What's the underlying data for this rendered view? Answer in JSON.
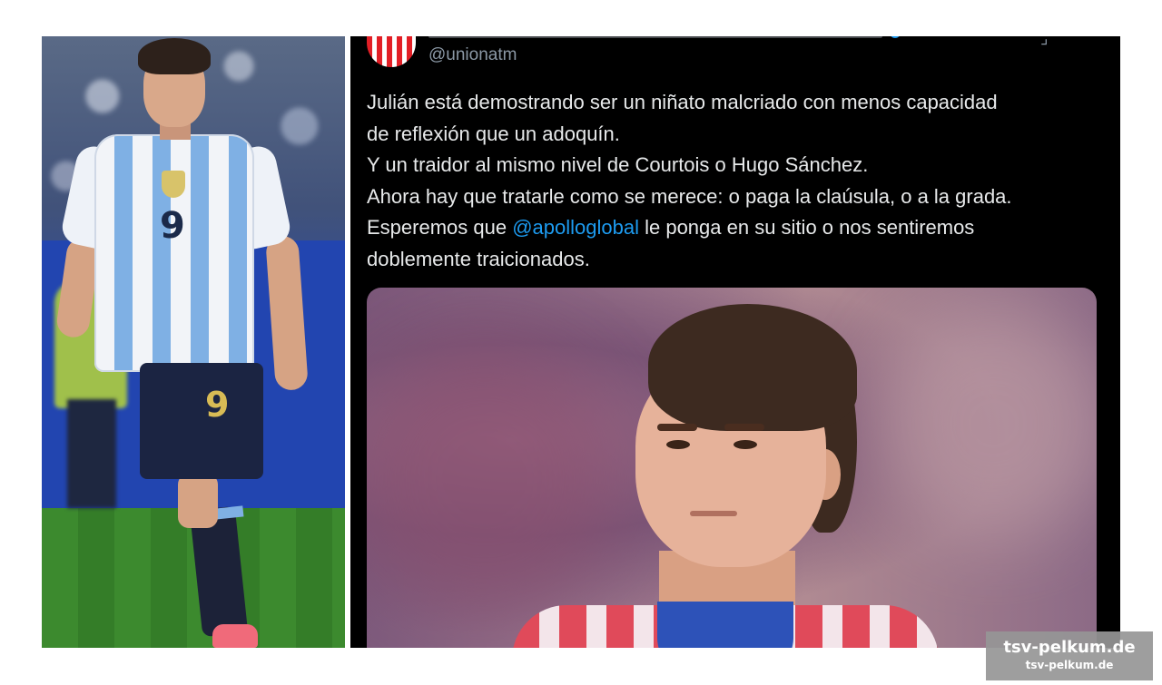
{
  "tweet": {
    "handle": "@unionatm",
    "lines": [
      "Julián está demostrando ser un niñato malcriado con menos capacidad",
      "de reflexión que un adoquín.",
      "Y un traidor al mismo nivel de Courtois o Hugo Sánchez.",
      "Ahora hay que tratarle como se merece: o paga la claúsula, o a la grada."
    ],
    "line5_prefix": "Esperemos que ",
    "mention": "@apolloglobal",
    "line5_suffix": " le ponga en su sitio o nos sentiremos",
    "line6": "doblemente traicionados.",
    "colors": {
      "background": "#000000",
      "text": "#e7e9ea",
      "secondary": "#8b98a5",
      "link": "#1d9bf0"
    }
  },
  "left_photo": {
    "jersey_number": "9",
    "shorts_number": "9"
  },
  "watermark": {
    "main": "tsv-pelkum.de",
    "sub": "tsv-pelkum.de"
  }
}
